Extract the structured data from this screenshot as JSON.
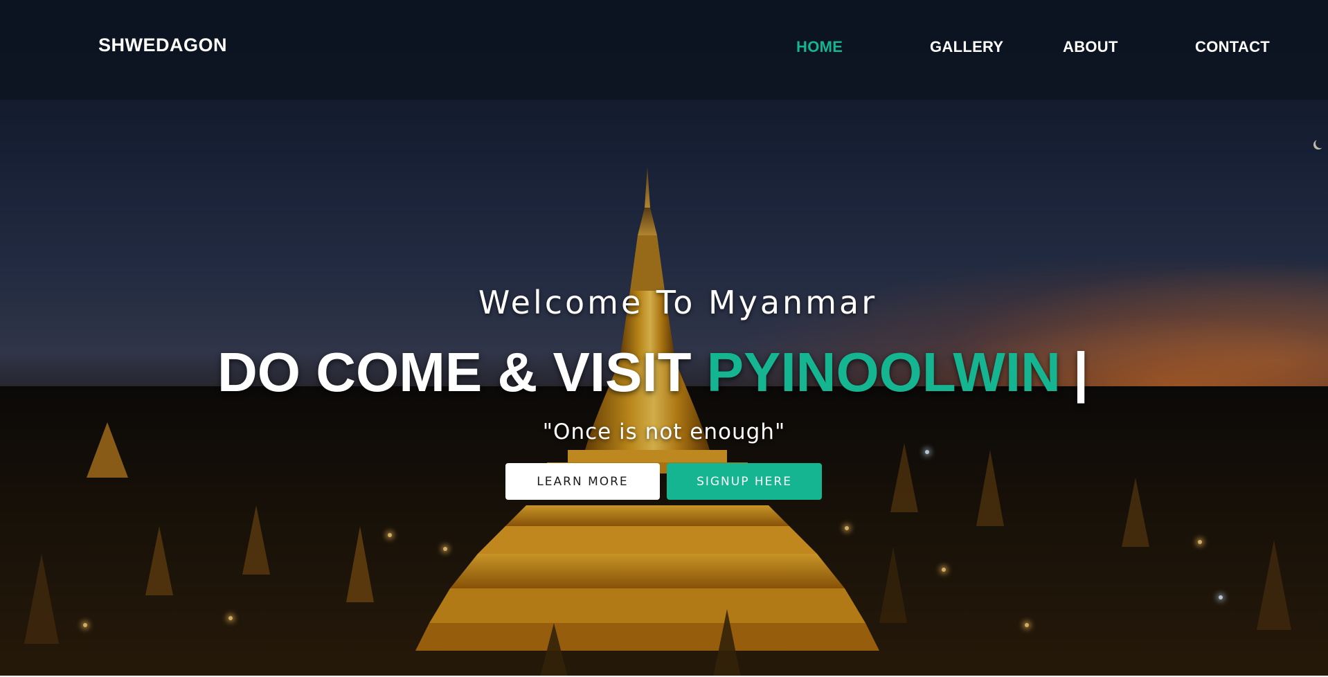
{
  "nav": {
    "brand": "SHWEDAGON",
    "links": [
      {
        "label": "HOME",
        "active": true
      },
      {
        "label": "GALLERY",
        "active": false
      },
      {
        "label": "ABOUT",
        "active": false
      },
      {
        "label": "CONTACT",
        "active": false
      }
    ]
  },
  "hero": {
    "subtitle": "Welcome To Myanmar",
    "title_prefix": "DO COME & VISIT",
    "title_highlight": "PYINOOLWIN",
    "cursor": "|",
    "quote": "\"Once is not enough\"",
    "buttons": {
      "learn_more": "LEARN MORE",
      "signup": "SIGNUP HERE"
    }
  },
  "colors": {
    "accent": "#14b590",
    "navbar_bg": "#0d1421",
    "text": "#ffffff"
  },
  "background": {
    "image": "night-view-of-golden-stupa-pagoda"
  }
}
